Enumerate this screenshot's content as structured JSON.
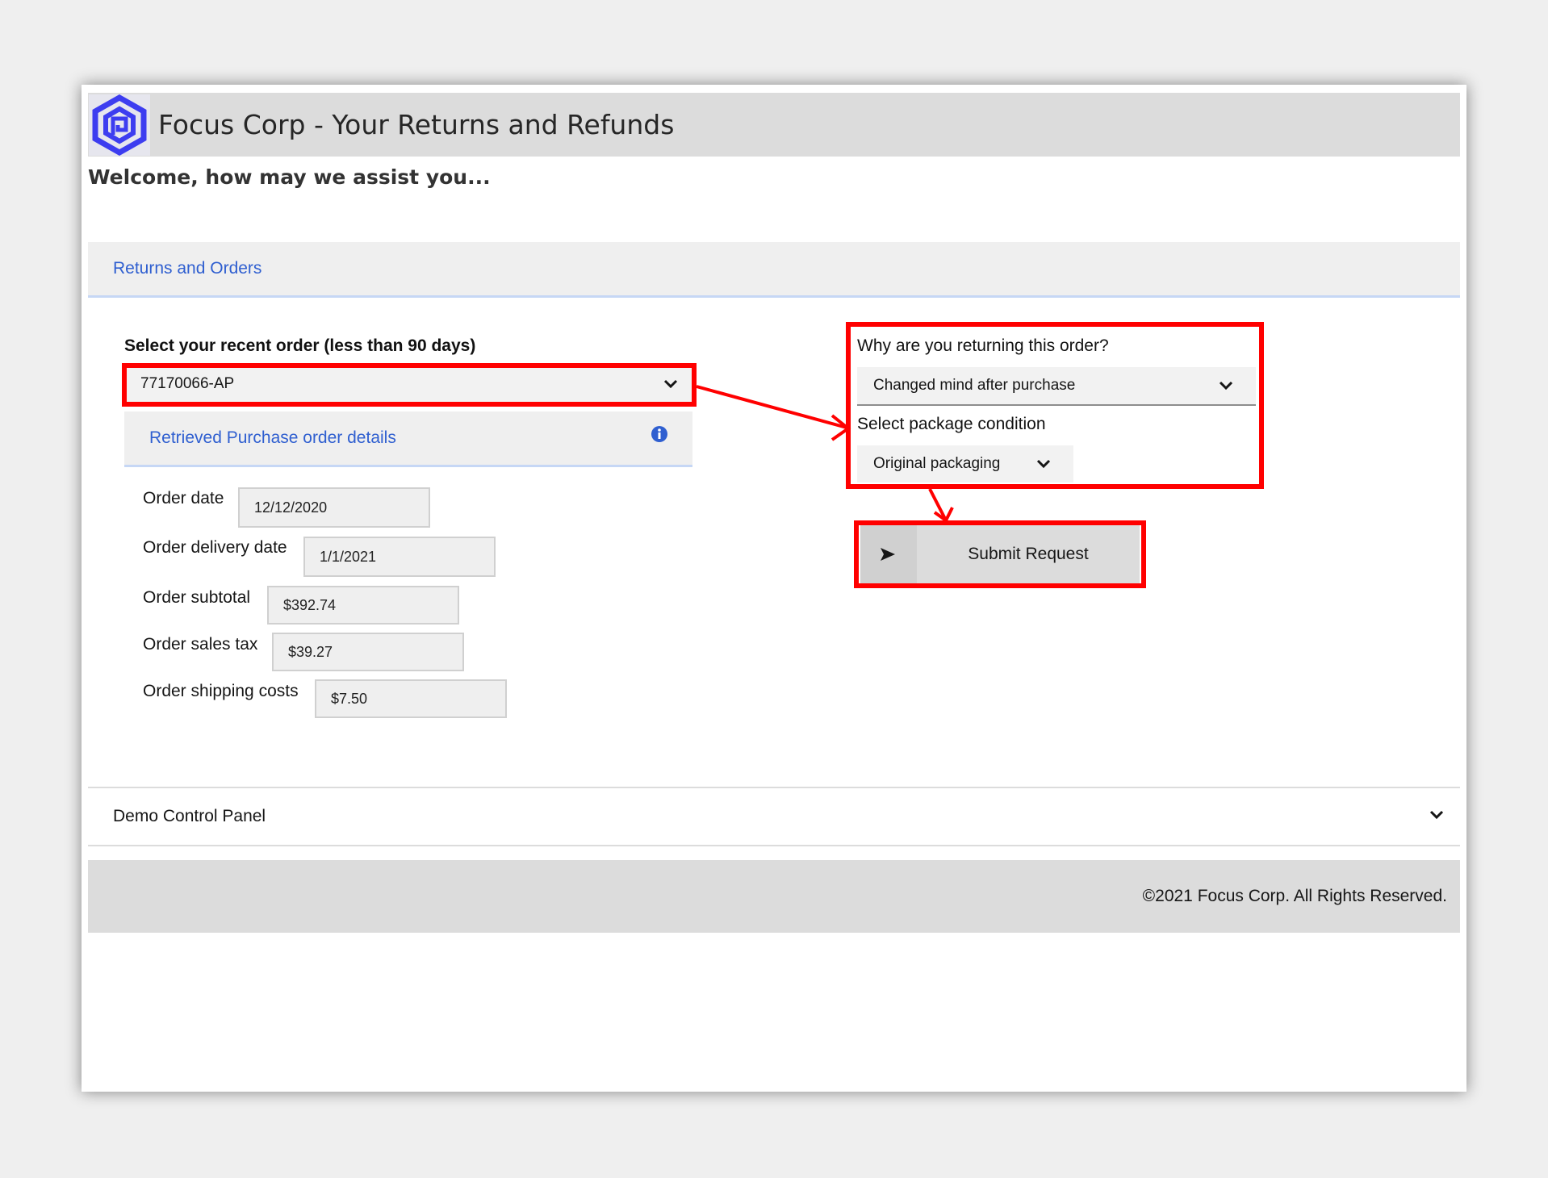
{
  "header": {
    "title": "Focus Corp - Your Returns and Refunds",
    "logo_icon": "hexagon-logo-icon"
  },
  "welcome": "Welcome, how may we assist you...",
  "section": {
    "title": "Returns and Orders"
  },
  "order_select": {
    "label": "Select your recent order (less than 90 days)",
    "value": "77170066-AP"
  },
  "details": {
    "title": "Retrieved Purchase order details",
    "fields": [
      {
        "label": "Order date",
        "value": "12/12/2020"
      },
      {
        "label": "Order delivery date",
        "value": "1/1/2021"
      },
      {
        "label": "Order subtotal",
        "value": "$392.74"
      },
      {
        "label": "Order sales tax",
        "value": "$39.27"
      },
      {
        "label": "Order shipping costs",
        "value": "$7.50"
      }
    ]
  },
  "return_reason": {
    "label": "Why are you returning this order?",
    "value": "Changed mind after purchase"
  },
  "package_condition": {
    "label": "Select package condition",
    "value": "Original packaging"
  },
  "submit": {
    "label": "Submit Request",
    "icon": "send-icon"
  },
  "demo_panel": {
    "label": "Demo Control Panel"
  },
  "footer": {
    "text": "©2021 Focus Corp. All Rights Reserved."
  },
  "colors": {
    "accent_blue": "#2f5fd0",
    "logo_blue": "#3d3df0",
    "annotation_red": "#ff0000"
  }
}
